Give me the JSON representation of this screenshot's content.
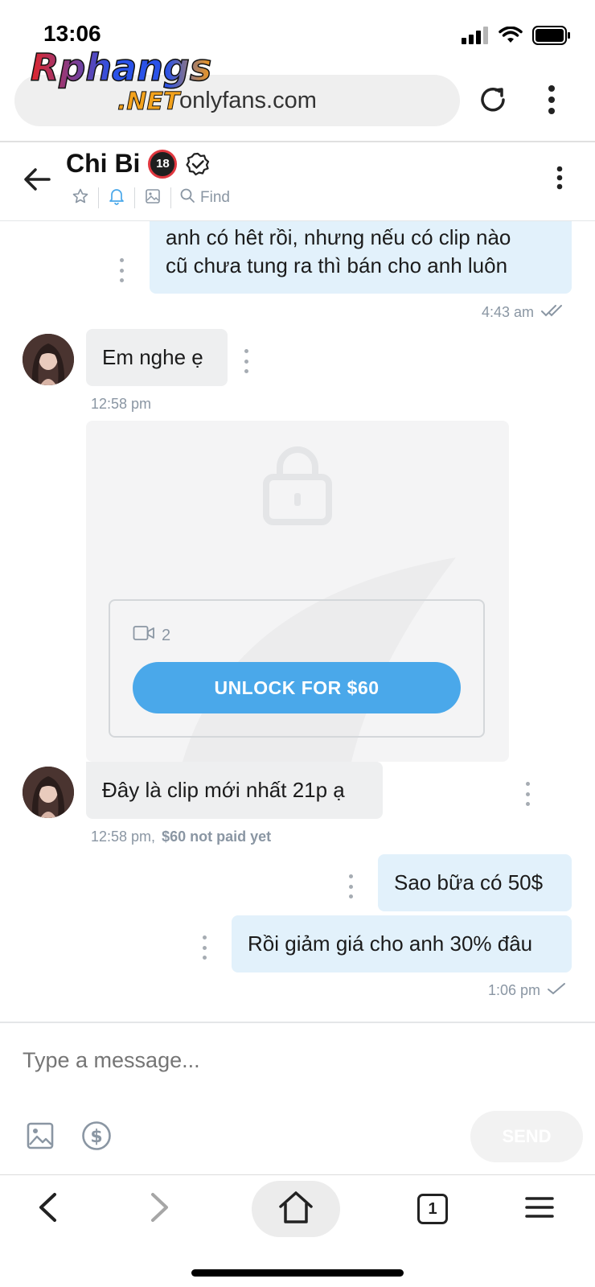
{
  "status_bar": {
    "time": "13:06"
  },
  "browser": {
    "url": "onlyfans.com",
    "watermark_line1": "Rphangs",
    "watermark_line2": ".NET",
    "icons": [
      "reload-icon",
      "more-vertical-icon"
    ]
  },
  "chat_header": {
    "name": "Chi Bi",
    "age_badge": "18",
    "find_label": "Find",
    "icons": [
      "back-arrow-icon",
      "verified-icon",
      "star-icon",
      "bell-icon",
      "image-icon",
      "search-icon",
      "more-vertical-icon"
    ]
  },
  "messages": [
    {
      "direction": "out",
      "lines": [
        "anh có hêt rồi, nhưng nếu có clip nào",
        "cũ chưa tung ra thì bán cho anh luôn"
      ],
      "time": "4:43 am",
      "status": "double-check"
    },
    {
      "direction": "in",
      "text": "Em nghe ẹ",
      "time": "12:58 pm"
    },
    {
      "direction": "in",
      "text": "Đây là clip mới nhất 21p ạ",
      "time": "12:58 pm,",
      "price_note": "$60 not paid yet",
      "locked_media": {
        "video_count": "2",
        "unlock_label": "UNLOCK FOR $60"
      }
    },
    {
      "direction": "out",
      "text": "Sao bữa có 50$"
    },
    {
      "direction": "out",
      "text": "Rồi giảm giá cho anh 30% đâu",
      "time": "1:06 pm",
      "status": "single-check"
    }
  ],
  "composer": {
    "placeholder": "Type a message...",
    "send_label": "SEND",
    "icons": [
      "image-icon",
      "dollar-icon"
    ]
  },
  "bottom_nav": {
    "tab_count": "1",
    "icons": [
      "back-icon",
      "forward-icon",
      "home-icon",
      "tabs-icon",
      "menu-icon"
    ]
  },
  "colors": {
    "accent": "#4aa8ea",
    "outgoing_bubble": "#e2f1fb",
    "incoming_bubble": "#eeeff0",
    "meta_text": "#8a96a3"
  }
}
